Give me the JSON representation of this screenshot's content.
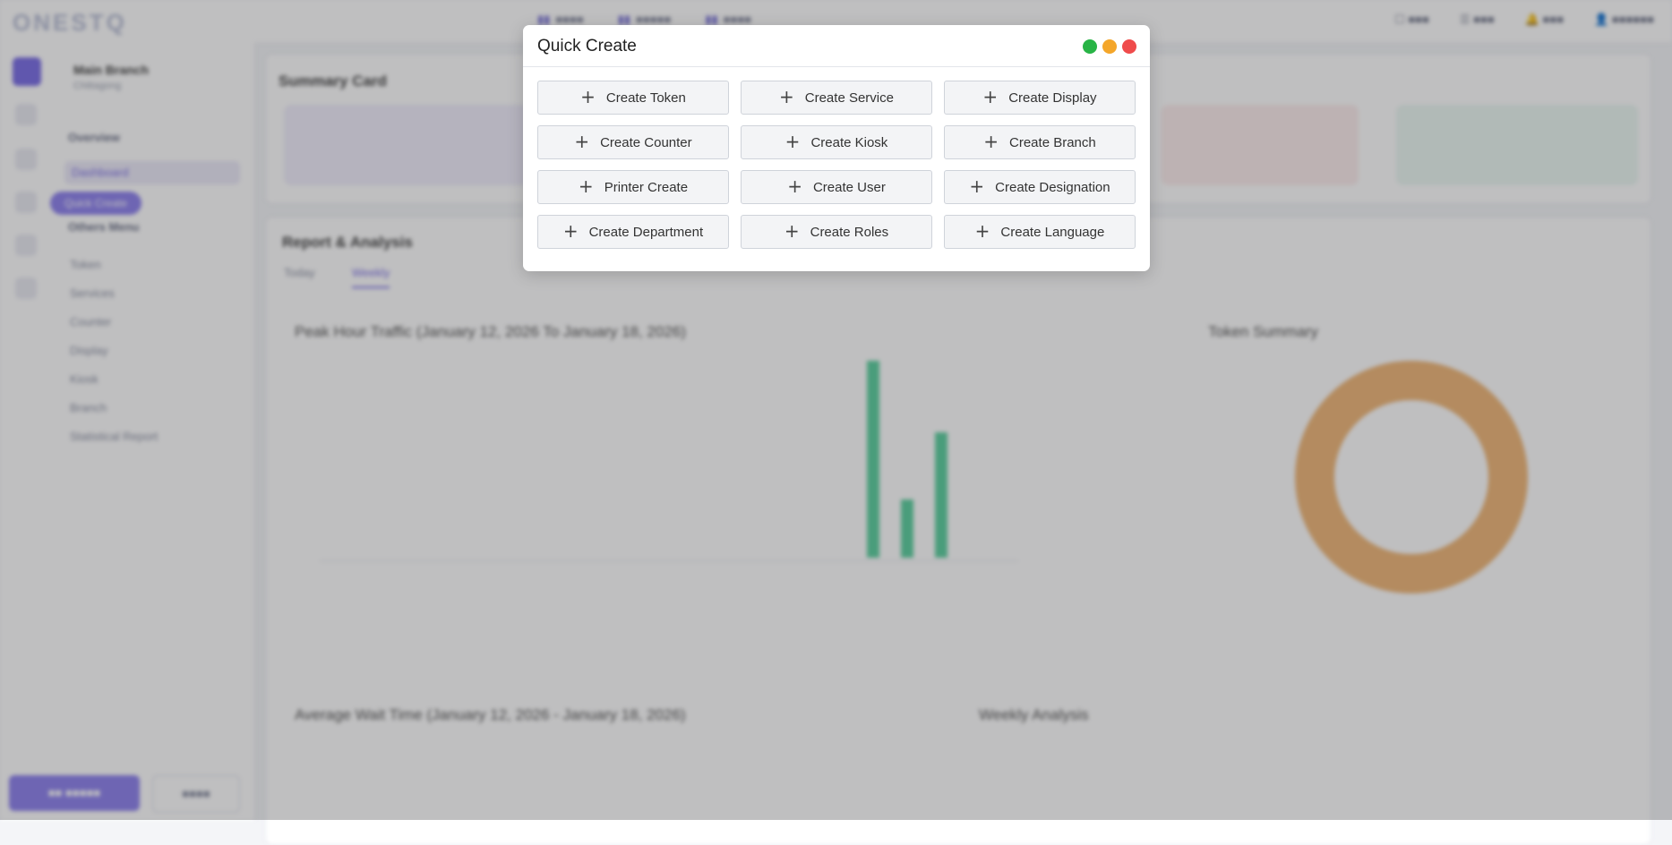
{
  "modal": {
    "title": "Quick Create",
    "buttons": [
      {
        "label": "Create Token"
      },
      {
        "label": "Create Service"
      },
      {
        "label": "Create Display"
      },
      {
        "label": "Create Counter"
      },
      {
        "label": "Create Kiosk"
      },
      {
        "label": "Create Branch"
      },
      {
        "label": "Printer Create"
      },
      {
        "label": "Create User"
      },
      {
        "label": "Create Designation"
      },
      {
        "label": "Create Department"
      },
      {
        "label": "Create Roles"
      },
      {
        "label": "Create Language"
      }
    ],
    "colors": {
      "close": "#ef4b4b",
      "minimize": "#f4a62a",
      "maximize": "#28b446"
    }
  },
  "background": {
    "logo": "ONESTQ",
    "branch": {
      "name": "Main Branch",
      "address": "Chittagong"
    },
    "sidebar": {
      "section_overview": "Overview",
      "dashboard": "Dashboard",
      "quick_create": "Quick Create",
      "section_menu": "Others Menu",
      "items": [
        "Token",
        "Services",
        "Counter",
        "Display",
        "Kiosk",
        "Branch",
        "Statistical Report"
      ]
    },
    "summary_title": "Summary Card",
    "report_title": "Report & Analysis",
    "tabs": [
      "Today",
      "Weekly"
    ],
    "chart1_title": "Peak Hour Traffic (January 12, 2026 To January 18, 2026)",
    "chart2_title": "Token Summary",
    "chart3_title": "Average Wait Time (January 12, 2026 - January 18, 2026)",
    "chart4_title": "Weekly Analysis",
    "accent": "#7c6fe6"
  }
}
